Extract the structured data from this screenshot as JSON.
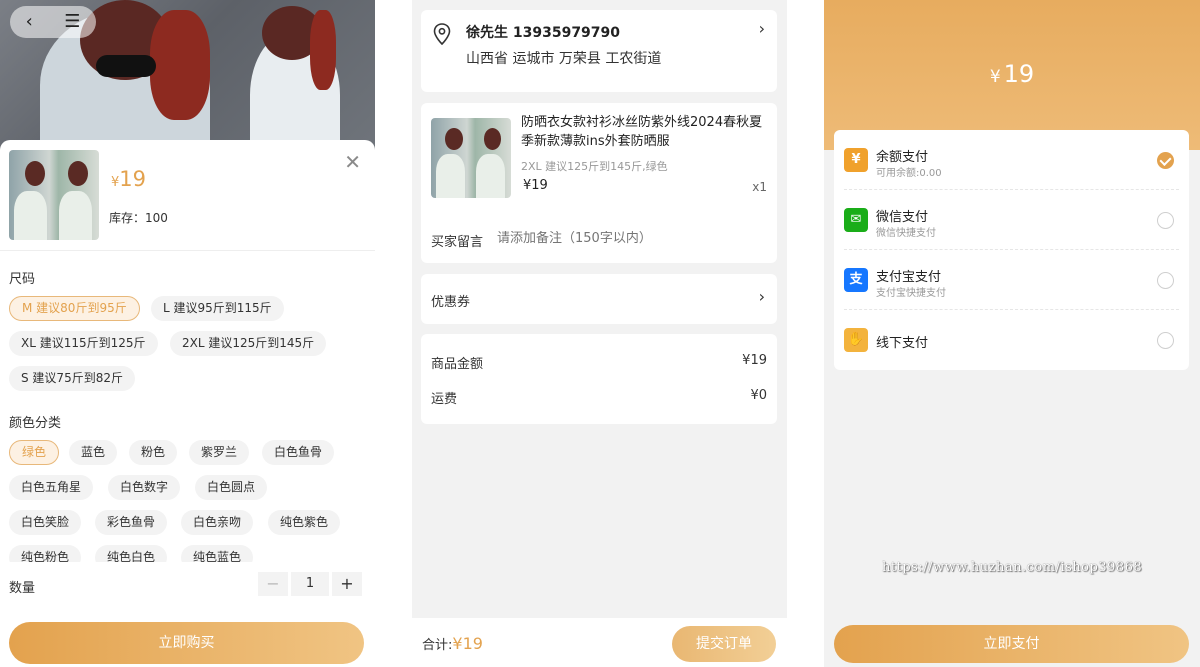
{
  "sku_panel": {
    "back_icon": "chevron-left-icon",
    "menu_icon": "menu-icon",
    "price": "19",
    "currency": "¥",
    "stock_label": "库存：100",
    "close_icon": "close-icon",
    "size_title": "尺码",
    "sizes": [
      {
        "label": "M 建议80斤到95斤",
        "selected": true
      },
      {
        "label": "L 建议95斤到115斤",
        "selected": false
      },
      {
        "label": "XL 建议115斤到125斤",
        "selected": false
      },
      {
        "label": "2XL 建议125斤到145斤",
        "selected": false
      },
      {
        "label": "S 建议75斤到82斤",
        "selected": false
      }
    ],
    "color_title": "颜色分类",
    "colors": [
      {
        "label": "绿色",
        "selected": true
      },
      {
        "label": "蓝色",
        "selected": false
      },
      {
        "label": "粉色",
        "selected": false
      },
      {
        "label": "紫罗兰",
        "selected": false
      },
      {
        "label": "白色鱼骨",
        "selected": false
      },
      {
        "label": "白色五角星",
        "selected": false
      },
      {
        "label": "白色数字",
        "selected": false
      },
      {
        "label": "白色圆点",
        "selected": false
      },
      {
        "label": "白色笑脸",
        "selected": false
      },
      {
        "label": "彩色鱼骨",
        "selected": false
      },
      {
        "label": "白色亲吻",
        "selected": false
      },
      {
        "label": "纯色紫色",
        "selected": false
      },
      {
        "label": "纯色粉色",
        "selected": false
      },
      {
        "label": "纯色白色",
        "selected": false
      },
      {
        "label": "纯色蓝色",
        "selected": false
      }
    ],
    "quantity_label": "数量",
    "quantity_value": "1",
    "minus": "−",
    "plus": "+",
    "buy_button": "立即购买"
  },
  "order_panel": {
    "address": {
      "pin_icon": "location-pin-icon",
      "name_phone": "徐先生 13935979790",
      "line": "山西省 运城市 万荣县 工农街道"
    },
    "goods": {
      "title": "防晒衣女款衬衫冰丝防紫外线2024春秋夏季新款薄款ins外套防晒服",
      "spec": "2XL 建议125斤到145斤,绿色",
      "price": "¥19",
      "qty": "x1"
    },
    "remark_label": "买家留言",
    "remark_placeholder": "请添加备注（150字以内）",
    "coupon_label": "优惠券",
    "amount_label": "商品金额",
    "amount_value": "¥19",
    "shipping_label": "运费",
    "shipping_value": "¥0",
    "total_label": "合计:",
    "total_value": "¥19",
    "submit_button": "提交订单"
  },
  "pay_panel": {
    "currency": "¥",
    "amount": "19",
    "methods": [
      {
        "name": "余额支付",
        "sub": "可用余额:0.00",
        "icon": "balance-icon",
        "color": "#f0a12c",
        "glyph": "¥",
        "checked": true
      },
      {
        "name": "微信支付",
        "sub": "微信快捷支付",
        "icon": "wechat-icon",
        "color": "#1aad19",
        "glyph": "✉",
        "checked": false
      },
      {
        "name": "支付宝支付",
        "sub": "支付宝快捷支付",
        "icon": "alipay-icon",
        "color": "#1677ff",
        "glyph": "支",
        "checked": false
      },
      {
        "name": "线下支付",
        "sub": "",
        "icon": "offline-pay-icon",
        "color": "#f3b33d",
        "glyph": "✋",
        "checked": false
      }
    ],
    "pay_button": "立即支付",
    "watermark": "https://www.huzhan.com/ishop39868"
  },
  "colors": {
    "accent": "#e3a24e",
    "accent_light": "#f0c483"
  }
}
